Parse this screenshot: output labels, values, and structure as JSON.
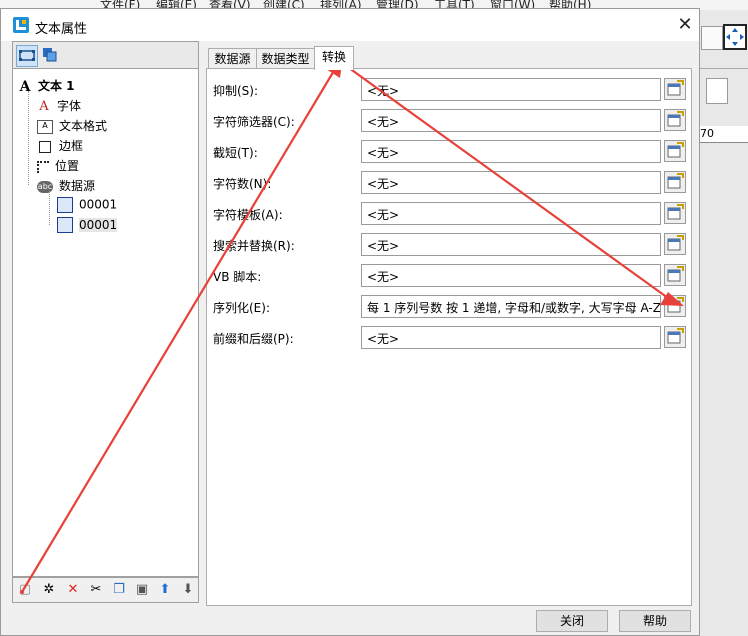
{
  "app_menu": [
    "文件(F)",
    "编辑(E)",
    "查看(V)",
    "创建(C)",
    "排列(A)",
    "管理(D)",
    "工具(T)",
    "窗口(W)",
    "帮助(H)"
  ],
  "app_ruler_number": "70",
  "dialog": {
    "title": "文本属性",
    "tree": {
      "root": "文本 1",
      "items": [
        "字体",
        "文本格式",
        "边框",
        "位置",
        "数据源"
      ],
      "sub_items": [
        "00001",
        "00001"
      ]
    },
    "tabs": [
      "数据源",
      "数据类型",
      "转换"
    ],
    "active_tab": 2,
    "rows": [
      {
        "label": "抑制(S):",
        "value": "<无>"
      },
      {
        "label": "字符筛选器(C):",
        "value": "<无>"
      },
      {
        "label": "截短(T):",
        "value": "<无>"
      },
      {
        "label": "字符数(N):",
        "value": "<无>"
      },
      {
        "label": "字符模板(A):",
        "value": "<无>"
      },
      {
        "label": "搜索并替换(R):",
        "value": "<无>"
      },
      {
        "label": "VB 脚本:",
        "value": "<无>"
      },
      {
        "label": "序列化(E):",
        "value": "每 1 序列号数 按 1 递增, 字母和/或数字, 大写字母 A-Z"
      },
      {
        "label": "前缀和后缀(P):",
        "value": "<无>"
      }
    ],
    "buttons": {
      "close": "关闭",
      "help": "帮助"
    }
  },
  "colors": {
    "annotation_arrow": "#e8413a",
    "accent": "#0078d7"
  }
}
